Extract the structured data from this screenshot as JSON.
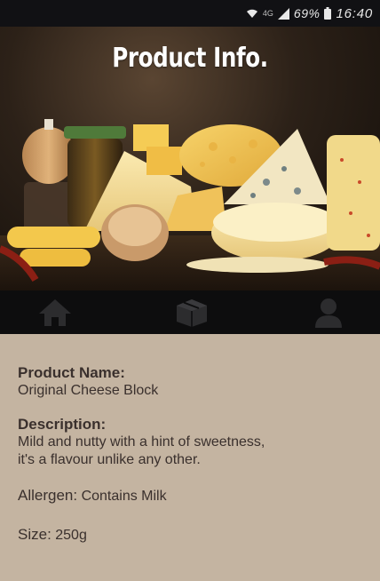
{
  "status_bar": {
    "network": "4G",
    "battery_percent": "69%",
    "time": "16:40"
  },
  "hero": {
    "title": "Product Info."
  },
  "nav": {
    "items": [
      {
        "icon": "home-icon"
      },
      {
        "icon": "box-icon"
      },
      {
        "icon": "user-icon"
      }
    ]
  },
  "product": {
    "name_label": "Product Name:",
    "name": "Original Cheese Block",
    "description_label": "Description:",
    "description_line1": "Mild and nutty with a hint of sweetness,",
    "description_line2": "it's a flavour unlike any other.",
    "allergen_label": "Allergen:",
    "allergen": "Contains Milk",
    "size_label": "Size:",
    "size": "250g"
  },
  "colors": {
    "status_bar": "#111114",
    "nav_bar": "#0d0d0e",
    "content_bg": "#c4b4a1",
    "text": "#3a302d"
  }
}
